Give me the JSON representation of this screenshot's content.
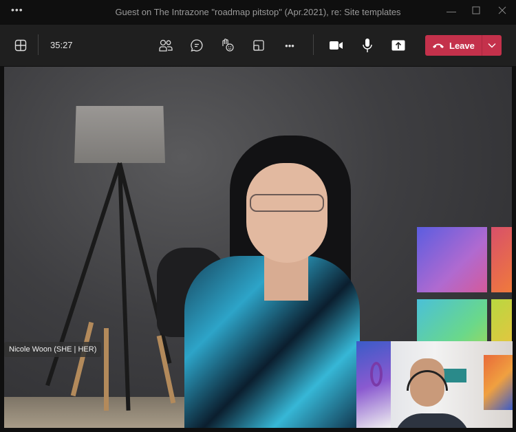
{
  "window": {
    "title": "Guest on The Intrazone \"roadmap pitstop\" (Apr.2021), re: Site templates",
    "menu_icon": "more-horizontal-icon",
    "minimize": "minimize-icon",
    "maximize": "maximize-icon",
    "close": "close-icon"
  },
  "toolbar": {
    "timer": "35:27",
    "leave_label": "Leave",
    "leave_color": "#c4314b",
    "icons": [
      "layout-grid-icon",
      "participants-icon",
      "chat-icon",
      "raise-hand-react-icon",
      "rooms-icon",
      "more-icon",
      "camera-icon",
      "mic-icon",
      "share-icon",
      "hangup-icon",
      "chevron-down-icon"
    ]
  },
  "stage": {
    "participant_name": "Nicole Woon (SHE | HER)"
  }
}
